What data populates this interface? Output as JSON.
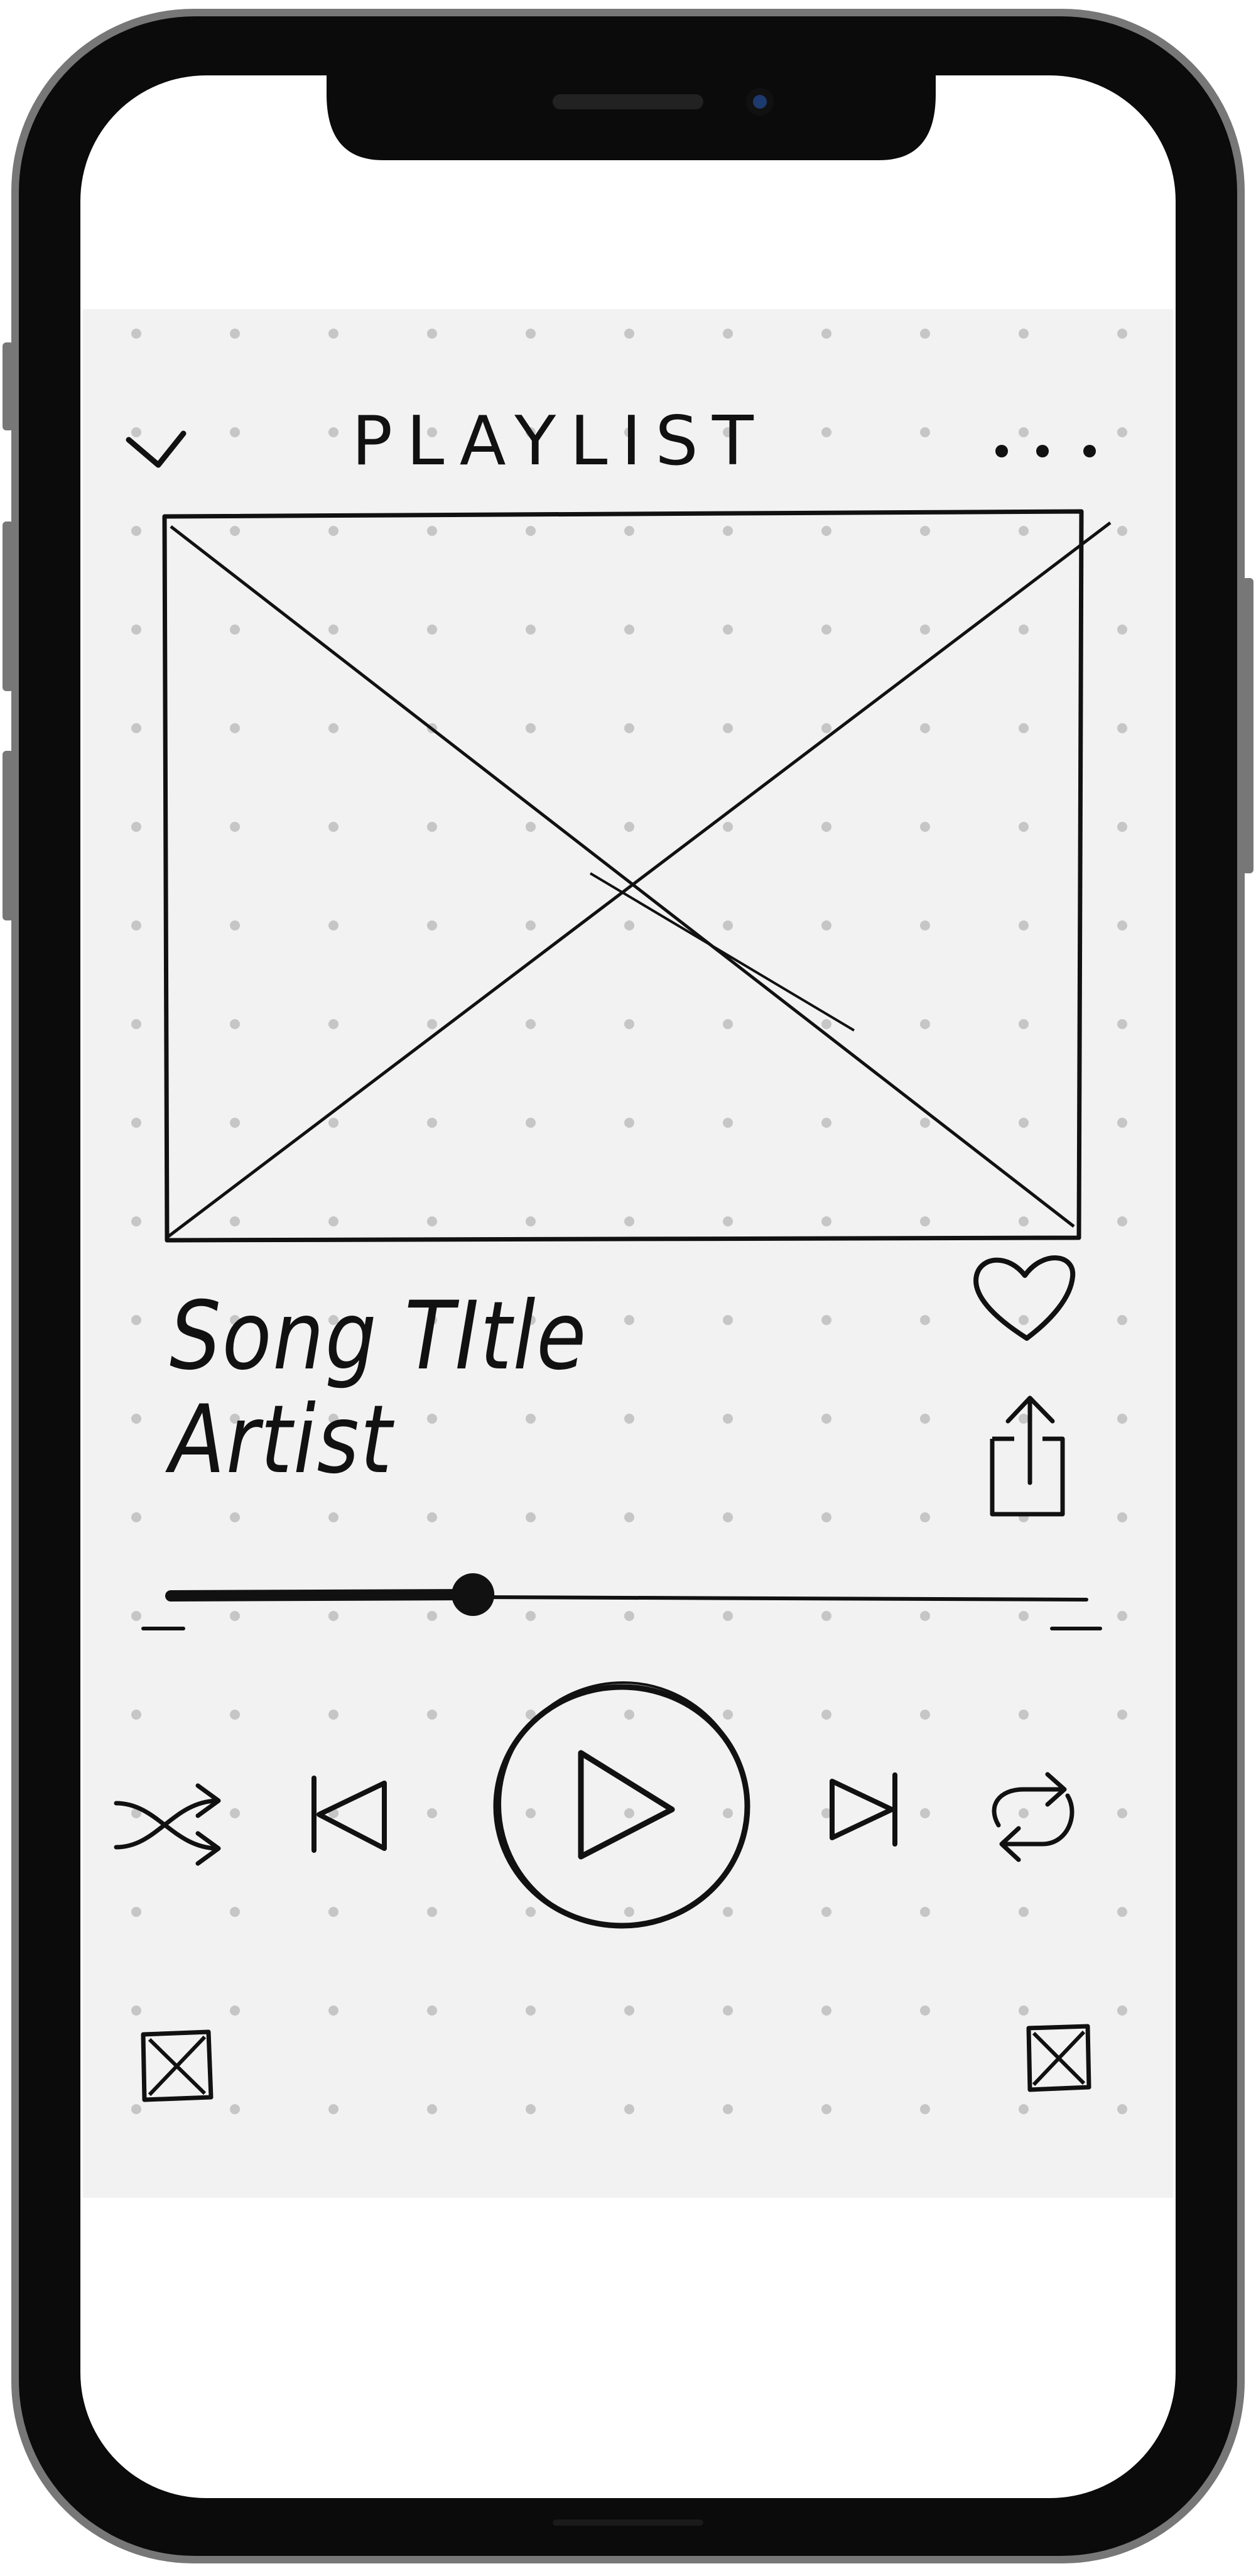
{
  "screen": {
    "title": "PLAYLIST",
    "now_playing": {
      "song_title": "Song TItle",
      "artist": "Artist",
      "progress": 0.33
    },
    "icons": {
      "back": "chevron-down-icon",
      "more": "more-dots-icon",
      "artwork": "image-placeholder-icon",
      "like": "heart-icon",
      "share": "share-icon",
      "shuffle": "shuffle-icon",
      "previous": "skip-previous-icon",
      "play": "play-icon",
      "next": "skip-next-icon",
      "repeat": "repeat-icon",
      "bottom_left": "placeholder-icon",
      "bottom_right": "placeholder-icon"
    }
  },
  "colors": {
    "ink": "#111111",
    "paper": "#f2f2f2",
    "dots": "#c6c6c6",
    "bezel": "#0b0b0b",
    "frame": "#6a6a6a"
  }
}
